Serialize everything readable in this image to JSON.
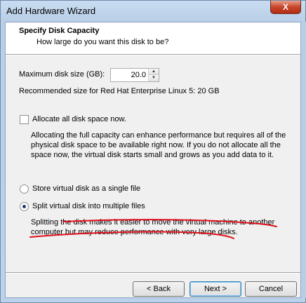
{
  "window": {
    "title": "Add Hardware Wizard",
    "close_label": "X"
  },
  "header": {
    "title": "Specify Disk Capacity",
    "subtitle": "How large do you want this disk to be?"
  },
  "disk_size": {
    "label": "Maximum disk size (GB):",
    "value": "20.0",
    "recommended": "Recommended size for Red Hat Enterprise Linux 5: 20 GB"
  },
  "allocate": {
    "label": "Allocate all disk space now.",
    "checked": false,
    "description_lines": [
      "Allocating the full capacity can enhance performance but requires all of the",
      "physical disk space to be available right now. If you do not allocate all the",
      "space now, the virtual disk starts small and grows as you add data to it."
    ]
  },
  "storage": {
    "single_label": "Store virtual disk as a single file",
    "split_label": "Split virtual disk into multiple files",
    "selected": "split",
    "split_description_lines": [
      "Splitting the disk makes it easier to move the virtual machine to another",
      "computer but may reduce performance with very large disks."
    ]
  },
  "annotation": {
    "color": "#e0101a",
    "style": "handwritten underline"
  },
  "buttons": {
    "back": "< Back",
    "next": "Next >",
    "cancel": "Cancel"
  },
  "icons": {
    "spin_up": "spin-up-arrow",
    "spin_down": "spin-down-arrow"
  }
}
